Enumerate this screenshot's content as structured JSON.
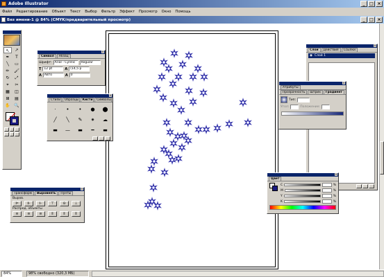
{
  "app": {
    "title": "Adobe Illustrator",
    "window_buttons": [
      "_",
      "□",
      "×"
    ]
  },
  "menu": [
    "Файл",
    "Редактирование",
    "Объект",
    "Текст",
    "Выбор",
    "Фильтр",
    "Эффект",
    "Просмотр",
    "Окно",
    "Помощь"
  ],
  "document": {
    "title": "Без имени-1 @ 84% (CMYK/предварительный просмотр)"
  },
  "status": {
    "zoom": "84%",
    "info": "98% свободно (320,3 МБ)"
  },
  "toolbox": {
    "tools": [
      "↖",
      "↗",
      "✒",
      "T",
      "╲",
      "▭",
      "✏",
      "🖌",
      "↻",
      "⤢",
      "⌖",
      "✂",
      "▦",
      "◫",
      "⊞",
      "▤",
      "✋",
      "🔍"
    ]
  },
  "character_panel": {
    "tabs": [
      "Символ",
      "Абзац"
    ],
    "font_label": "Шрифт:",
    "font_value": "Arial - Cyrillic",
    "style_value": "Regular",
    "size_value": "12 pt",
    "leading_value": "(14,5 p",
    "kerning_value": "Авто",
    "tracking_value": "0"
  },
  "brushes_panel": {
    "tabs": [
      "Стили",
      "Образцы",
      "Кисти",
      "Символы"
    ],
    "brushes": [
      "·",
      "•",
      "•",
      "●",
      "⬤",
      "╱",
      "╲",
      "✎",
      "⁕",
      "☁",
      "❦",
      "~",
      "⇢",
      "≈",
      "▬",
      "—",
      "▬",
      "━",
      "▬",
      "▬"
    ]
  },
  "align_panel": {
    "tabs": [
      "Трансформ",
      "Выровнять",
      "Пунты"
    ],
    "align_label": "Выров.",
    "distribute_label": "Распред. объекты"
  },
  "layers_panel": {
    "tabs": [
      "Слои",
      "Действия",
      "Ссылки"
    ],
    "layer_name": "Слой 1"
  },
  "attributes_panel": {
    "tabs": [
      "Атрибуты"
    ],
    "subtabs": [
      "Прозрачность",
      "Штрих",
      "Градиент"
    ],
    "type_label": "Тип:",
    "angle_label": "Угол:",
    "position_label": "Положение:"
  },
  "color_panel": {
    "tabs": [
      "Цвет"
    ],
    "channels": [
      "C",
      "M",
      "Y",
      "K"
    ],
    "unit": "%"
  },
  "colors": {
    "star_fill": "#2a2a9a",
    "star_inner": "#ffffff",
    "title_bar": "#0a246a"
  },
  "artwork": {
    "stars": [
      [
        251,
        77
      ],
      [
        272,
        80
      ],
      [
        236,
        90
      ],
      [
        263,
        93
      ],
      [
        243,
        99
      ],
      [
        285,
        99
      ],
      [
        233,
        111
      ],
      [
        257,
        111
      ],
      [
        278,
        111
      ],
      [
        294,
        111
      ],
      [
        249,
        121
      ],
      [
        226,
        129
      ],
      [
        272,
        131
      ],
      [
        293,
        134
      ],
      [
        235,
        141
      ],
      [
        250,
        149
      ],
      [
        278,
        147
      ],
      [
        261,
        159
      ],
      [
        240,
        177
      ],
      [
        271,
        177
      ],
      [
        286,
        187
      ],
      [
        297,
        187
      ],
      [
        313,
        185
      ],
      [
        330,
        179
      ],
      [
        350,
        148
      ],
      [
        357,
        177
      ],
      [
        245,
        191
      ],
      [
        256,
        197
      ],
      [
        265,
        196
      ],
      [
        271,
        203
      ],
      [
        250,
        207
      ],
      [
        262,
        213
      ],
      [
        236,
        216
      ],
      [
        243,
        222
      ],
      [
        248,
        231
      ],
      [
        257,
        229
      ],
      [
        222,
        233
      ],
      [
        218,
        244
      ],
      [
        237,
        249
      ],
      [
        221,
        271
      ],
      [
        219,
        291
      ],
      [
        227,
        297
      ],
      [
        213,
        296
      ]
    ]
  }
}
